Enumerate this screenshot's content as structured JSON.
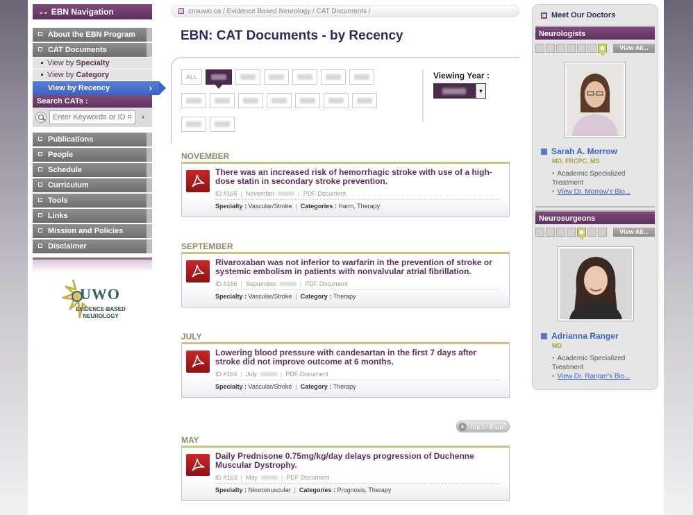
{
  "sidebar": {
    "nav_title": "EBN Navigation",
    "items": [
      {
        "label": "About the EBN Program"
      },
      {
        "label": "CAT Documents"
      }
    ],
    "sub": [
      {
        "pre": "View by",
        "bold": "Specialty"
      },
      {
        "pre": "View by",
        "bold": "Category"
      }
    ],
    "active": "View by Recency",
    "search_title": "Search CATs :",
    "search_placeholder": "Enter Keywords or ID #",
    "search_go": "›",
    "more": [
      {
        "label": "Publications"
      },
      {
        "label": "People"
      },
      {
        "label": "Schedule"
      },
      {
        "label": "Curriculum"
      },
      {
        "label": "Tools"
      },
      {
        "label": "Links"
      },
      {
        "label": "Mission and Policies"
      },
      {
        "label": "Disclaimer"
      }
    ],
    "logo_main": "UWO",
    "logo_line1": "EVIDENCE-BASED",
    "logo_line2": "NEUROLOGY"
  },
  "breadcrumb": "cnsuwo.ca / Evidence Based Neurology / CAT Documents /",
  "page_title": "EBN: CAT Documents - by Recency",
  "filter": {
    "all_label": "ALL",
    "viewing_year_label": "Viewing Year :",
    "dropdown_arrow": "▼"
  },
  "entries": [
    {
      "month": "NOVEMBER",
      "title": "There was an increased risk of hemorrhagic stroke with use of a high-dose statin in secondary stroke prevention.",
      "id": "ID #165",
      "date": "November",
      "type": "PDF Document",
      "specialty_label": "Specialty :",
      "specialty": "Vascular/Stroke",
      "cat_label": "Categories :",
      "categories": "Harm, Therapy"
    },
    {
      "month": "SEPTEMBER",
      "title": "Rivaroxaban was not inferior to warfarin in the prevention of stroke or systemic embolism in patients with nonvalvular atrial fibrillation.",
      "id": "ID #166",
      "date": "September",
      "type": "PDF Document",
      "specialty_label": "Specialty :",
      "specialty": "Vascular/Stroke",
      "cat_label": "Category :",
      "categories": "Therapy"
    },
    {
      "month": "JULY",
      "title": "Lowering blood pressure with candesartan in the first 7 days after stroke did not improve outcome at 6 months.",
      "id": "ID #164",
      "date": "July",
      "type": "PDF Document",
      "specialty_label": "Specialty :",
      "specialty": "Vascular/Stroke",
      "cat_label": "Category :",
      "categories": "Therapy"
    },
    {
      "month": "MAY",
      "title": "Daily Prednisone 0.75mg/kg/day delays progression of Duchenne Muscular Dystrophy.",
      "id": "ID #163",
      "date": "May",
      "type": "PDF Document",
      "specialty_label": "Specialty :",
      "specialty": "Neuromuscular",
      "cat_label": "Categories :",
      "categories": "Prognosis, Therapy"
    }
  ],
  "top_of_page": "Top of Page",
  "right": {
    "title": "Meet Our Doctors",
    "view_all": "View All...",
    "groups": [
      {
        "heading": "Neurologists",
        "name": "Sarah A. Morrow",
        "cred": "MD, FRCPC, MS",
        "specialty": "Academic Specialized Treatment",
        "bio": "View Dr. Morrow's Bio..."
      },
      {
        "heading": "Neurosurgeons",
        "name": "Adrianna Ranger",
        "cred": "MD",
        "specialty": "Academic Specialized Treatment",
        "bio": "View Dr. Ranger's Bio..."
      }
    ]
  },
  "colors": {
    "brand_purple": "#5f2f5d",
    "active_blue": "#3b62c4",
    "title_navy": "#2b2b5e",
    "accent_olive": "#c9c388"
  }
}
